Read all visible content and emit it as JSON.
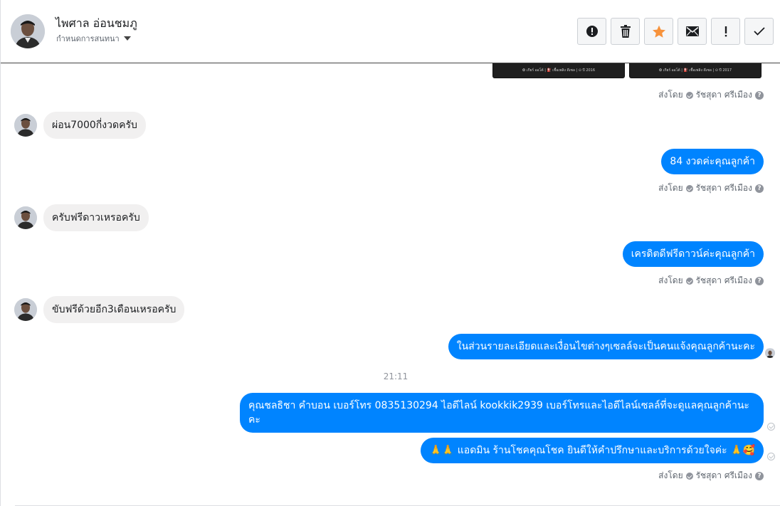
{
  "header": {
    "contact_name": "ไพศาล อ่อนชมภู",
    "assign_label": "กำหนดการสนทนา",
    "actions": [
      {
        "icon": "alert-circle-icon",
        "name": "report-button"
      },
      {
        "icon": "trash-icon",
        "name": "delete-button"
      },
      {
        "icon": "star-icon",
        "name": "star-button"
      },
      {
        "icon": "envelope-icon",
        "name": "mark-unread-button"
      },
      {
        "icon": "exclamation-icon",
        "name": "spam-button"
      },
      {
        "icon": "check-icon",
        "name": "done-button"
      }
    ],
    "star_color": "#f7923b"
  },
  "top_images": {
    "left_caption": "❂ เกียร์ ออโต้ | ⛽ เชื้อเพลิง ดีเซล | ⊙ ปี 2016",
    "right_caption": "❂ เกียร์ ออโต้ | ⛽ เชื้อเพลิง ดีเซล | ⊙ ปี 2017"
  },
  "sent_by": {
    "prefix": "ส่งโดย",
    "agent": "รัชสุดา ศรีเมือง"
  },
  "messages": [
    {
      "direction": "in",
      "text": "ผ่อน7000กี่งวดครับ"
    },
    {
      "direction": "out",
      "text": "84  งวดค่ะคุณลูกค้า"
    },
    {
      "direction": "in",
      "text": "ครับฟรีดาวเหรอครับ"
    },
    {
      "direction": "out",
      "text": "เครดิตดีฟรีดาวน์ค่ะคุณลูกค้า"
    },
    {
      "direction": "in",
      "text": "ขับฟรีด้วยอีก3เดือนเหรอครับ"
    },
    {
      "direction": "out",
      "text": "ในส่วนรายละเอียดและเงื่อนไขต่างๆเซลล์จะเป็นคนแจ้งคุณลูกค้านะคะ"
    },
    {
      "direction": "out",
      "text": "คุณชลธิชา คำบอน  เบอร์โทร 0835130294  ไอดีไลน์ kookkik2939  เบอร์โทรและไอดีไลน์เซลล์ที่จะดูแลคุณลูกค้านะคะ"
    },
    {
      "direction": "out",
      "text": "แอดมิน ร้านโชคคุณโชค ยินดีให้คำปรึกษาและบริการด้วยใจค่ะ",
      "emoji_before": "🙏🙏",
      "emoji_after": "🙏🥰"
    }
  ],
  "timestamp": "21:11",
  "colors": {
    "outgoing_bubble": "#0084ff",
    "incoming_bubble": "#f1f0f0"
  }
}
